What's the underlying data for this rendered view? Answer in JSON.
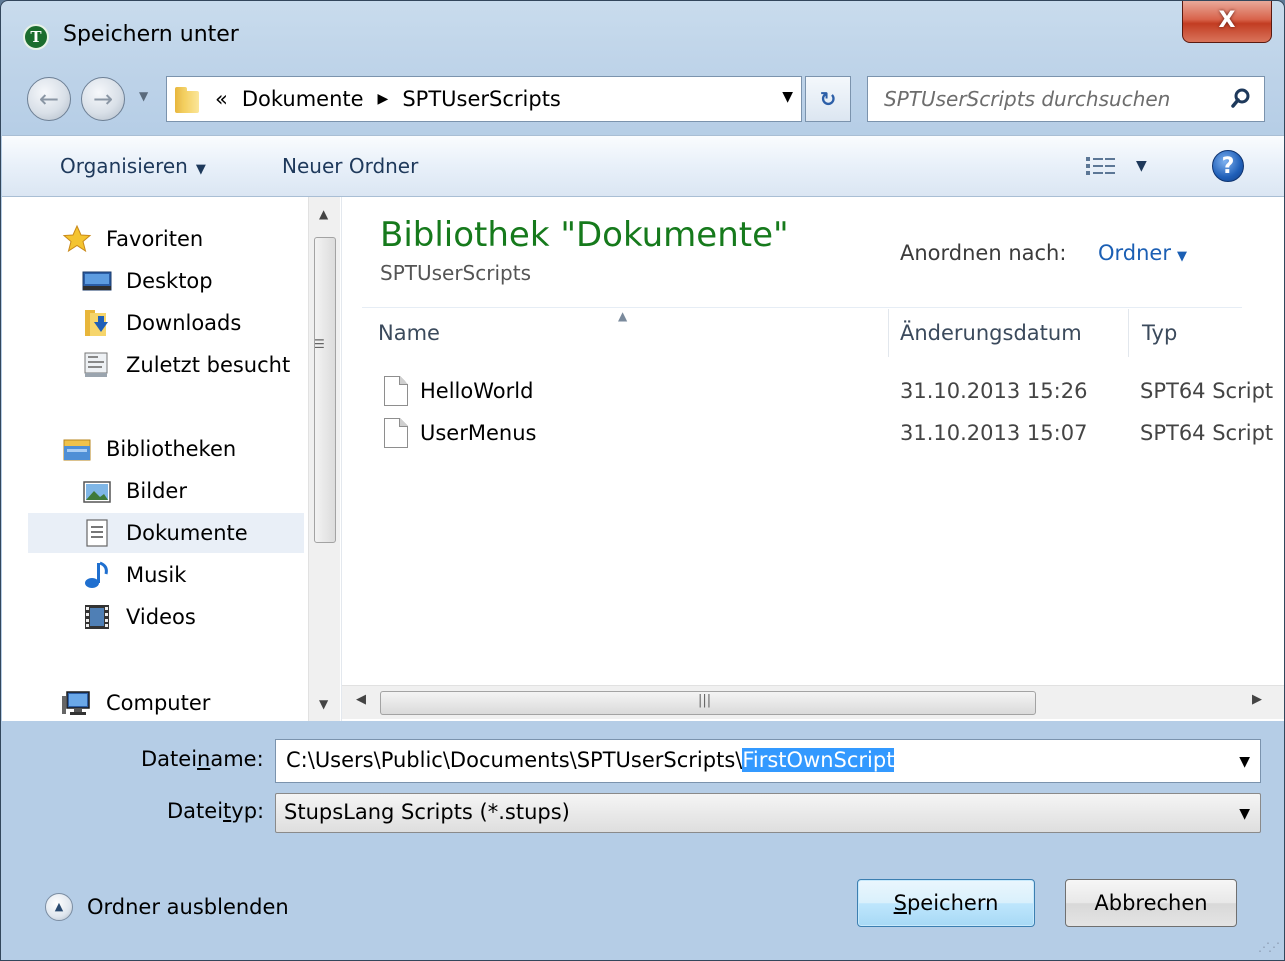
{
  "window": {
    "title": "Speichern unter",
    "close_label": "X"
  },
  "address_bar": {
    "overflow": "«",
    "crumbs": [
      "Dokumente",
      "SPTUserScripts"
    ]
  },
  "search": {
    "placeholder": "SPTUserScripts durchsuchen"
  },
  "toolbar": {
    "organize_label": "Organisieren",
    "new_folder_label": "Neuer Ordner"
  },
  "sidebar": {
    "items": [
      {
        "label": "Favoriten",
        "icon": "star-icon"
      },
      {
        "label": "Desktop",
        "icon": "desktop-icon"
      },
      {
        "label": "Downloads",
        "icon": "downloads-icon"
      },
      {
        "label": "Zuletzt besucht",
        "icon": "recent-places-icon"
      },
      {
        "label": "Bibliotheken",
        "icon": "libraries-icon"
      },
      {
        "label": "Bilder",
        "icon": "pictures-icon"
      },
      {
        "label": "Dokumente",
        "icon": "documents-icon",
        "selected": true
      },
      {
        "label": "Musik",
        "icon": "music-icon"
      },
      {
        "label": "Videos",
        "icon": "videos-icon"
      },
      {
        "label": "Computer",
        "icon": "computer-icon"
      }
    ]
  },
  "main": {
    "library_title": "Bibliothek \"Dokumente\"",
    "library_subtitle": "SPTUserScripts",
    "arrange_label": "Anordnen nach:",
    "arrange_value": "Ordner",
    "columns": [
      "Name",
      "Änderungsdatum",
      "Typ"
    ],
    "files": [
      {
        "name": "HelloWorld",
        "date": "31.10.2013 15:26",
        "type": "SPT64 Script"
      },
      {
        "name": "UserMenus",
        "date": "31.10.2013 15:07",
        "type": "SPT64 Script"
      }
    ]
  },
  "form": {
    "filename_label_pre": "Datei",
    "filename_label_u": "n",
    "filename_label_post": "ame:",
    "filename_path": "C:\\Users\\Public\\Documents\\SPTUserScripts\\",
    "filename_selected": "FirstOwnScript",
    "filetype_label_pre": "Datei",
    "filetype_label_u": "t",
    "filetype_label_post": "yp:",
    "filetype_value": "StupsLang Scripts (*.stups)"
  },
  "footer": {
    "hide_folders_label": "Ordner ausblenden",
    "save_u": "S",
    "save_rest": "peichern",
    "cancel_label": "Abbrechen"
  },
  "colors": {
    "library_title": "#167a1c",
    "link_blue": "#1b5fb4",
    "selection": "#3399ff"
  }
}
